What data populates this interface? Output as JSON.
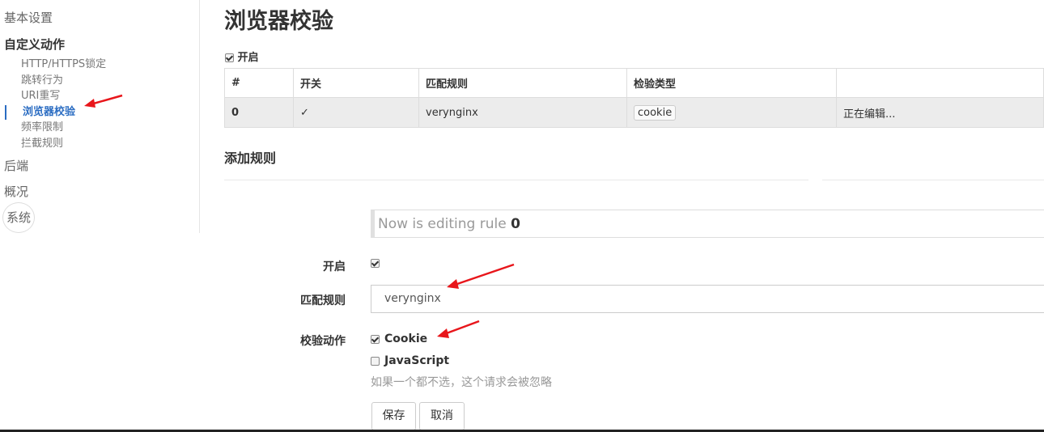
{
  "sidebar": {
    "items": [
      {
        "label": "基本设置"
      },
      {
        "label": "自定义动作"
      },
      {
        "label": "后端"
      },
      {
        "label": "概况"
      },
      {
        "label": "系统"
      }
    ],
    "sub_items": [
      {
        "label": "HTTP/HTTPS锁定"
      },
      {
        "label": "跳转行为"
      },
      {
        "label": "URI重写"
      },
      {
        "label": "浏览器校验"
      },
      {
        "label": "频率限制"
      },
      {
        "label": "拦截规则"
      }
    ]
  },
  "main": {
    "title": "浏览器校验",
    "enable_label": "开启",
    "enable_checked": true,
    "table": {
      "headers": [
        "#",
        "开关",
        "匹配规则",
        "检验类型",
        ""
      ],
      "rows": [
        {
          "index": "0",
          "switch": "✓",
          "match": "verynginx",
          "type": "cookie",
          "status": "正在编辑..."
        }
      ]
    },
    "add_rule_title": "添加规则",
    "editing_text": "Now is editing rule",
    "editing_rule": "0",
    "form": {
      "enable_label": "开启",
      "match_label": "匹配规则",
      "match_value": "verynginx",
      "action_label": "校验动作",
      "cookie_label": "Cookie",
      "js_label": "JavaScript",
      "hint": "如果一个都不选，这个请求会被忽略",
      "save": "保存",
      "cancel": "取消"
    }
  },
  "colors": {
    "accent": "#2a6cc2",
    "annotation_arrow": "#e8161b"
  }
}
